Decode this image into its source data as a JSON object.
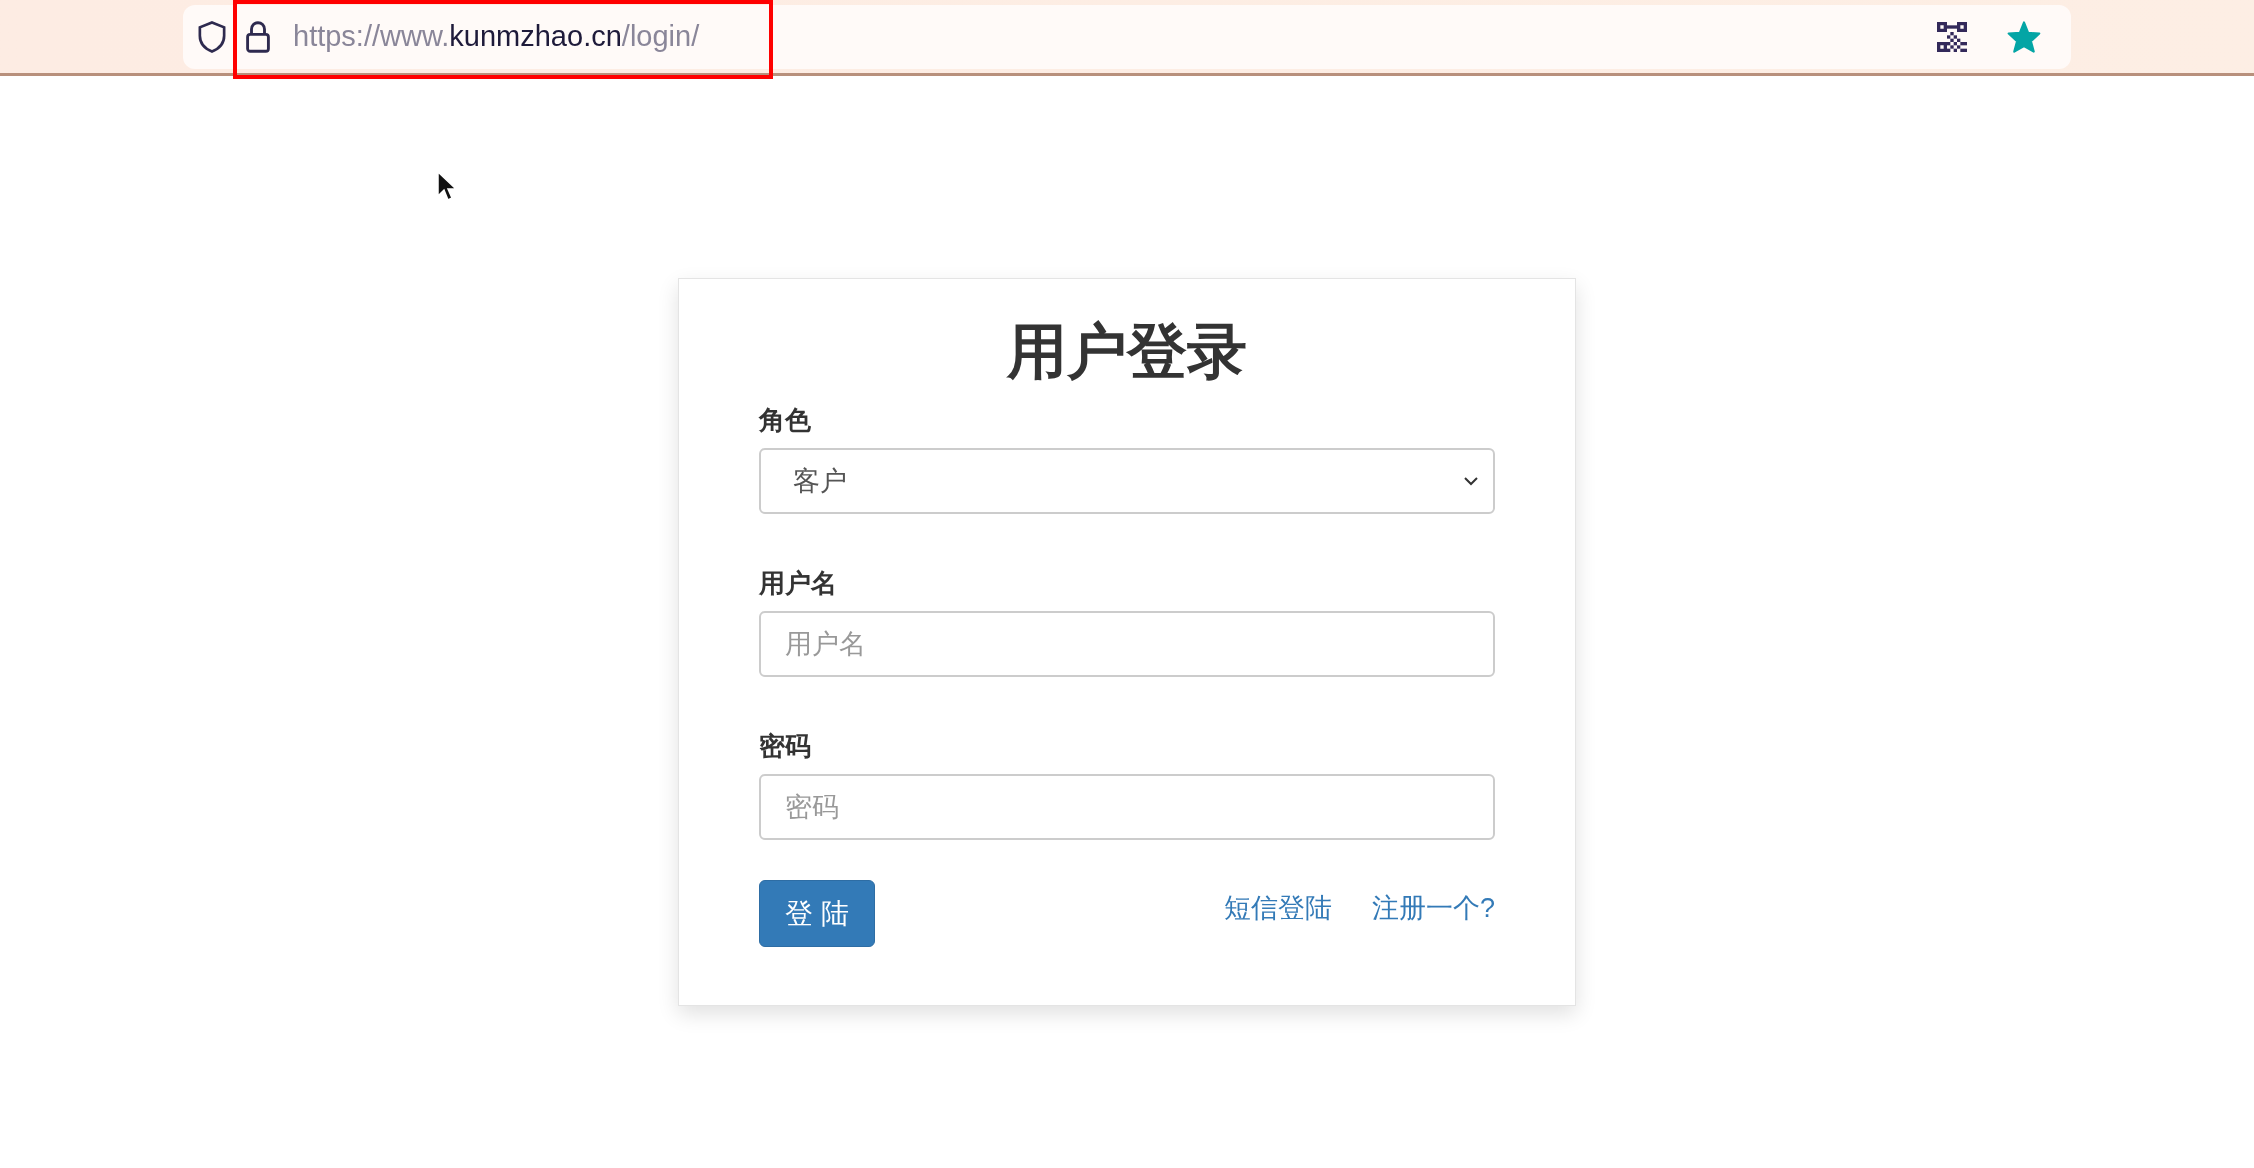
{
  "browser": {
    "url": {
      "prefix": "https://www.",
      "domain": "kunmzhao.cn",
      "path": "/login/"
    },
    "bookmarked": true,
    "highlighted": true
  },
  "login": {
    "title": "用户登录",
    "fields": [
      {
        "kind": "select",
        "label": "角色",
        "value": "客户"
      },
      {
        "kind": "text",
        "label": "用户名",
        "placeholder": "用户名"
      },
      {
        "kind": "password",
        "label": "密码",
        "placeholder": "密码"
      }
    ],
    "submit": "登 陆",
    "links": [
      "短信登陆",
      "注册一个?"
    ]
  }
}
